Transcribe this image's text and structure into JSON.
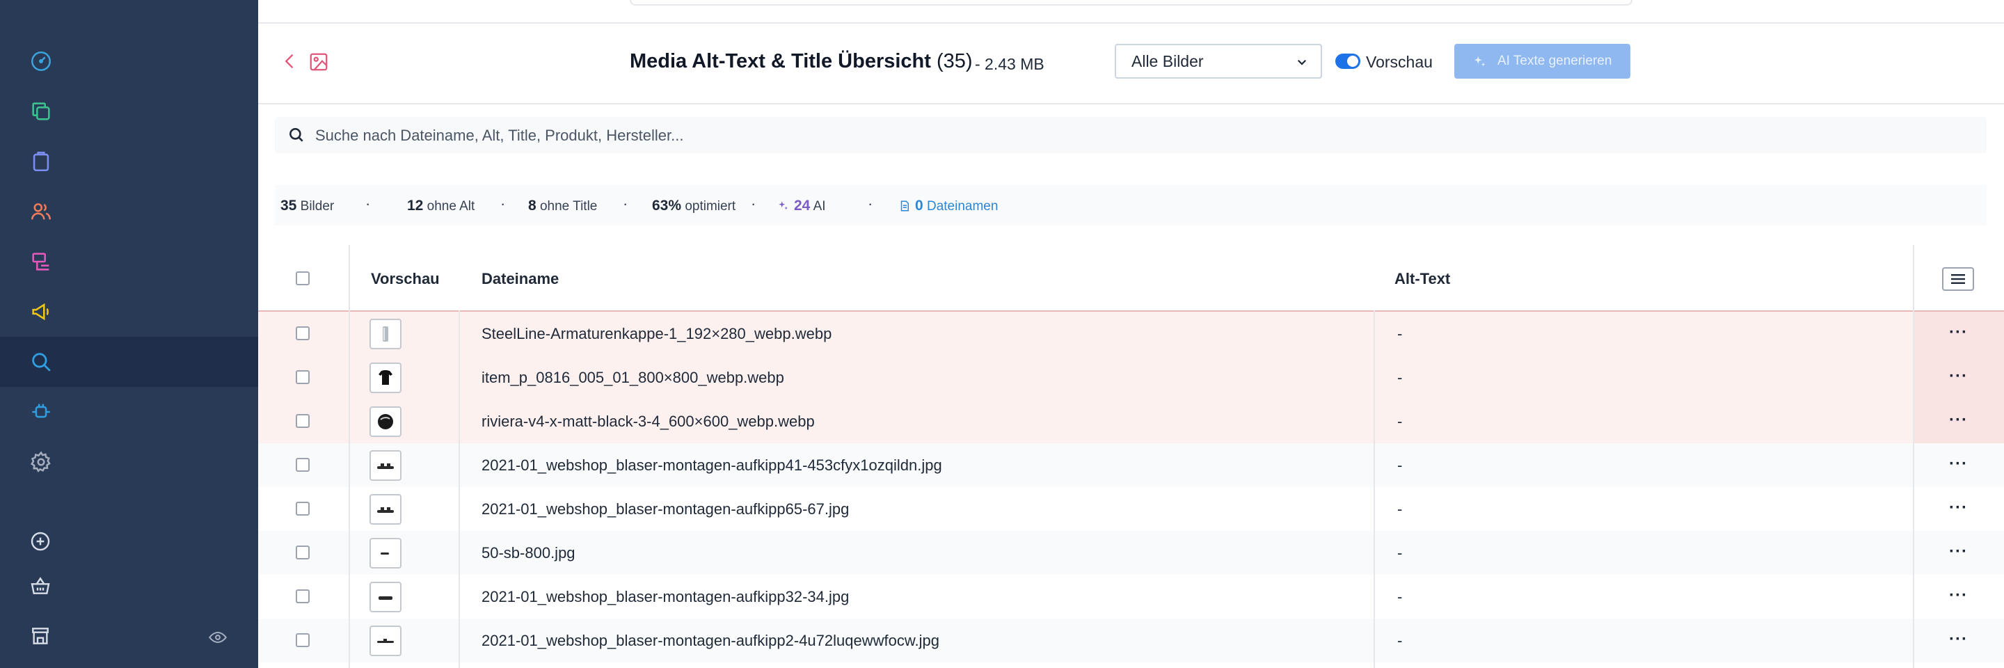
{
  "header": {
    "title": "Media Alt-Text & Title Übersicht",
    "count": "(35)",
    "size": "- 2.43 MB",
    "filter": "Alle Bilder",
    "preview_label": "Vorschau",
    "ai_button": "AI Texte generieren"
  },
  "search": {
    "placeholder": "Suche nach Dateiname, Alt, Title, Produkt, Hersteller..."
  },
  "stats": {
    "images_value": "35",
    "images_label": "Bilder",
    "no_alt_value": "12",
    "no_alt_label": "ohne Alt",
    "no_title_value": "8",
    "no_title_label": "ohne Title",
    "optimized_value": "63%",
    "optimized_label": "optimiert",
    "ai_value": "24",
    "ai_label": "AI",
    "filenames_value": "0",
    "filenames_label": "Dateinamen",
    "separator": "·"
  },
  "table": {
    "columns": {
      "preview": "Vorschau",
      "filename": "Dateiname",
      "alt": "Alt-Text"
    },
    "rows": [
      {
        "filename": "SteelLine-Armaturenkappe-1_192×280_webp.webp",
        "alt": "-",
        "more": "···"
      },
      {
        "filename": "item_p_0816_005_01_800×800_webp.webp",
        "alt": "-",
        "more": "···"
      },
      {
        "filename": "riviera-v4-x-matt-black-3-4_600×600_webp.webp",
        "alt": "-",
        "more": "···"
      },
      {
        "filename": "2021-01_webshop_blaser-montagen-aufkipp41-453cfyx1ozqildn.jpg",
        "alt": "-",
        "more": "···"
      },
      {
        "filename": "2021-01_webshop_blaser-montagen-aufkipp65-67.jpg",
        "alt": "-",
        "more": "···"
      },
      {
        "filename": "50-sb-800.jpg",
        "alt": "-",
        "more": "···"
      },
      {
        "filename": "2021-01_webshop_blaser-montagen-aufkipp32-34.jpg",
        "alt": "-",
        "more": "···"
      },
      {
        "filename": "2021-01_webshop_blaser-montagen-aufkipp2-4u72luqewwfocw.jpg",
        "alt": "-",
        "more": "···"
      }
    ]
  },
  "colors": {
    "sidebar_bg": "#293a56",
    "sidebar_active": "#1f2f4b",
    "accent_blue": "#1d72e8",
    "flagged_row": "#fdf1f0"
  },
  "icons": {
    "sidebar": [
      "dashboard-icon",
      "copy-icon",
      "clipboard-icon",
      "users-icon",
      "content-icon",
      "megaphone-icon",
      "search-icon",
      "plugin-icon",
      "gear-icon"
    ],
    "sidebar_bottom": [
      "plus-circle-icon",
      "basket-icon",
      "store-icon",
      "eye-icon"
    ]
  }
}
